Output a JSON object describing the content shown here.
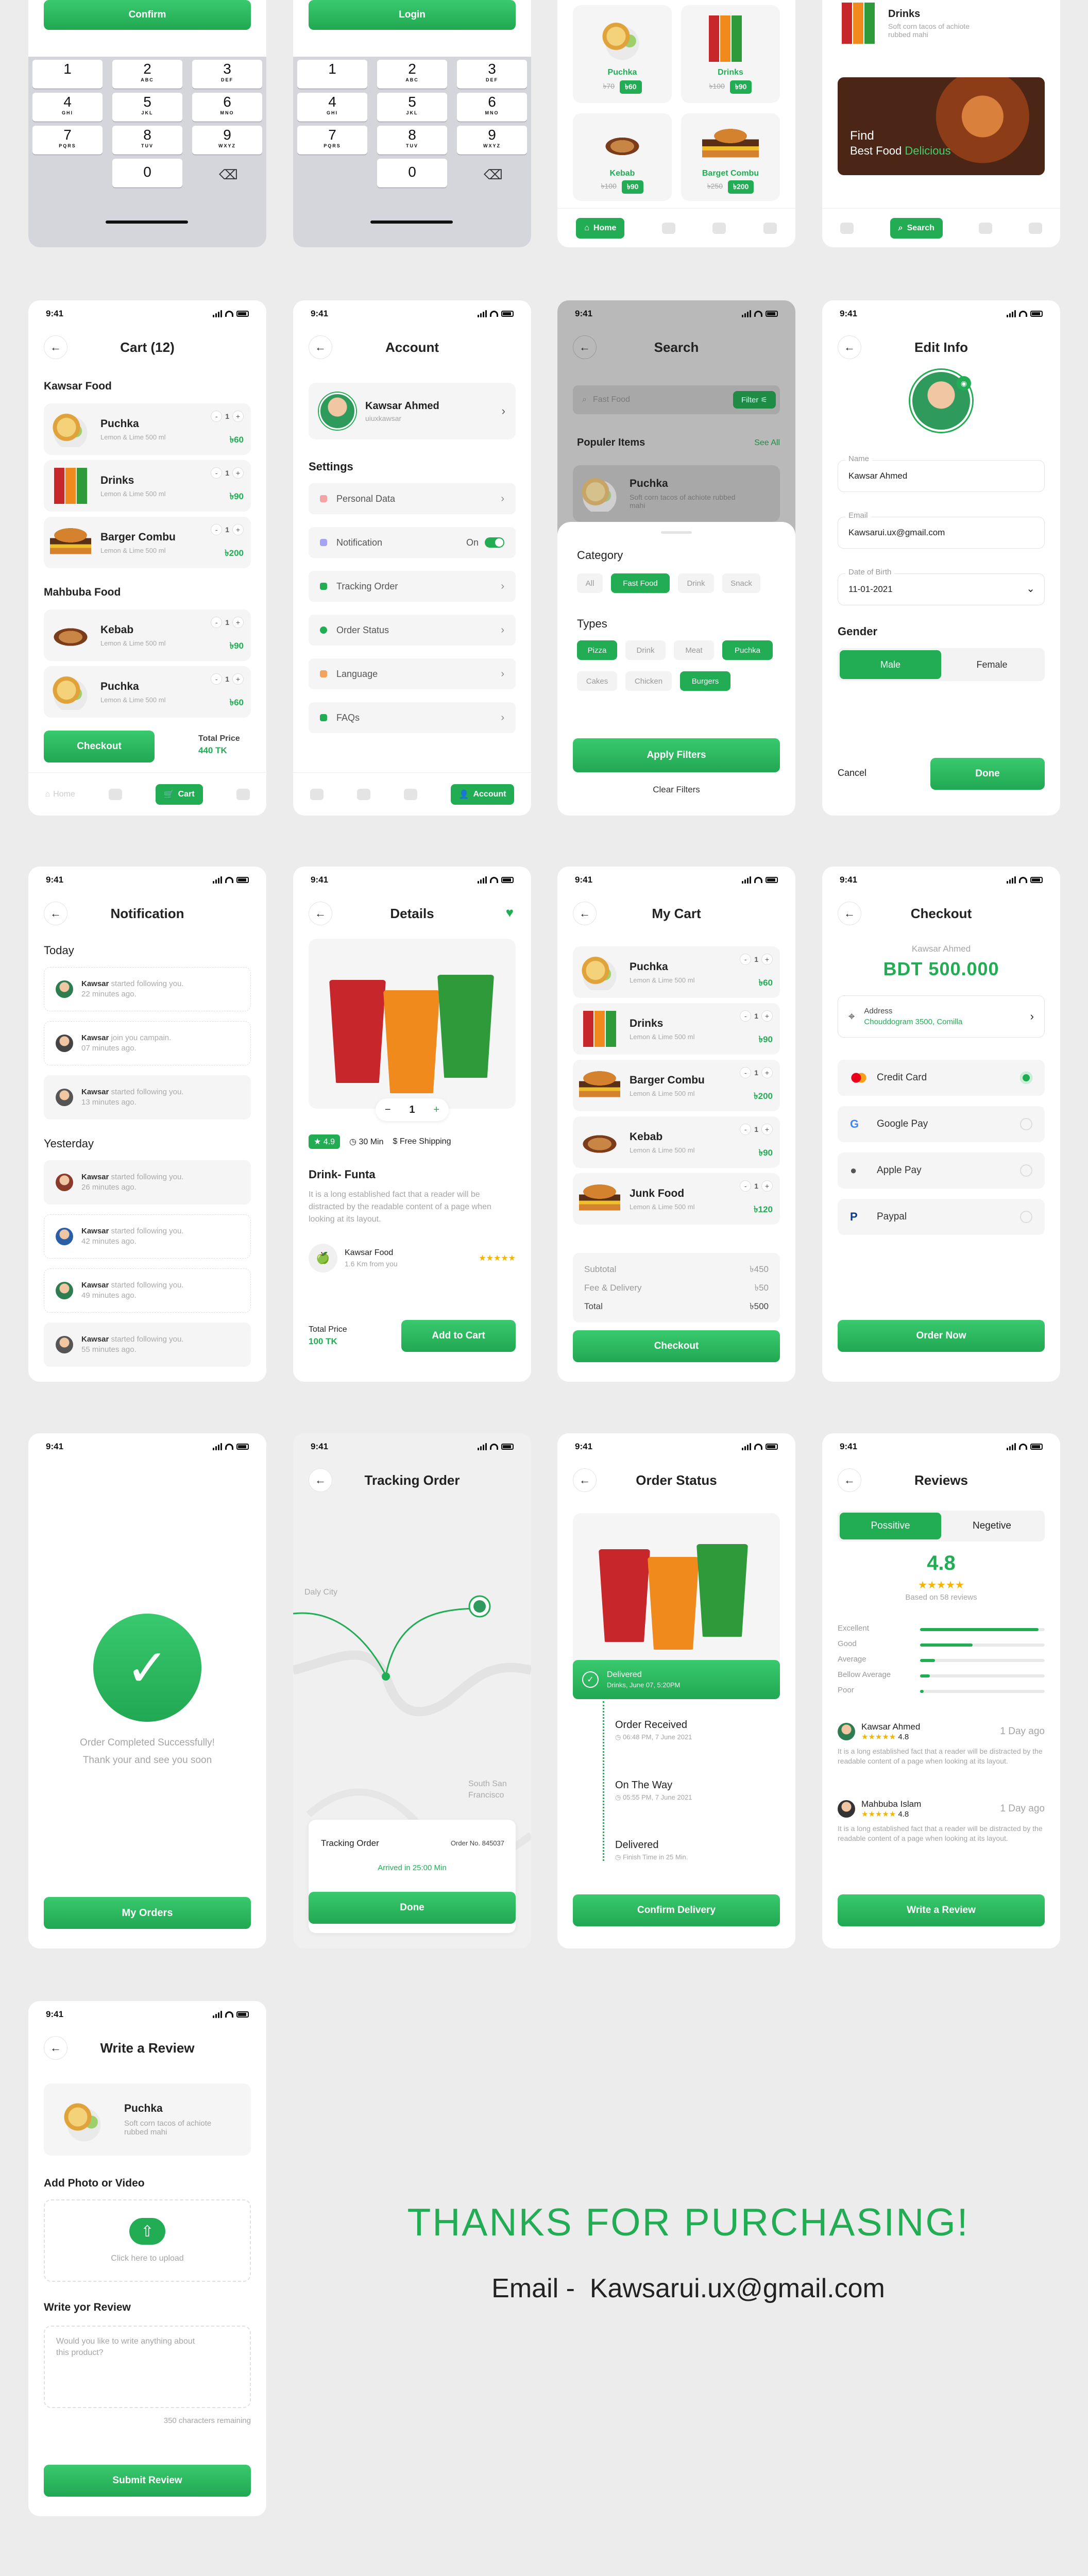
{
  "status_time": "9:41",
  "confirm_screen": {
    "button": "Confirm"
  },
  "login_screen": {
    "button": "Login"
  },
  "keypad": [
    {
      "num": "1",
      "letters": ""
    },
    {
      "num": "2",
      "letters": "ABC"
    },
    {
      "num": "3",
      "letters": "DEF"
    },
    {
      "num": "4",
      "letters": "GHI"
    },
    {
      "num": "5",
      "letters": "JKL"
    },
    {
      "num": "6",
      "letters": "MNO"
    },
    {
      "num": "7",
      "letters": "PQRS"
    },
    {
      "num": "8",
      "letters": "TUV"
    },
    {
      "num": "9",
      "letters": "WXYZ"
    },
    {
      "num": "0",
      "letters": ""
    }
  ],
  "home_grid": {
    "items": [
      {
        "name": "Puchka",
        "old": "৳70",
        "new": "৳60"
      },
      {
        "name": "Drinks",
        "old": "৳100",
        "new": "৳90"
      },
      {
        "name": "Kebab",
        "old": "৳100",
        "new": "৳90"
      },
      {
        "name": "Barget Combu",
        "old": "৳250",
        "new": "৳200"
      }
    ],
    "nav_active": "Home"
  },
  "search_home": {
    "item_name": "Drinks",
    "item_desc": "Soft corn tacos of achiote rubbed mahi",
    "banner_line1": "Find",
    "banner_line2": "Best Food",
    "banner_accent": "Delicious",
    "nav_active": "Search"
  },
  "cart": {
    "title": "Cart (12)",
    "section1": "Kawsar Food",
    "section2": "Mahbuba Food",
    "items1": [
      {
        "name": "Puchka",
        "sub": "Lemon & Lime 500 ml",
        "qty": "1",
        "price": "৳60"
      },
      {
        "name": "Drinks",
        "sub": "Lemon & Lime 500 ml",
        "qty": "1",
        "price": "৳90"
      },
      {
        "name": "Barger Combu",
        "sub": "Lemon & Lime 500 ml",
        "qty": "1",
        "price": "৳200"
      }
    ],
    "items2": [
      {
        "name": "Kebab",
        "sub": "Lemon & Lime 500 ml",
        "qty": "1",
        "price": "৳90"
      },
      {
        "name": "Puchka",
        "sub": "Lemon & Lime 500 ml",
        "qty": "1",
        "price": "৳60"
      }
    ],
    "checkout": "Checkout",
    "total_label": "Total Price",
    "total_value": "440 TK",
    "nav_home": "Home",
    "nav_active": "Cart"
  },
  "account": {
    "title": "Account",
    "name": "Kawsar Ahmed",
    "handle": "uiuxkawsar",
    "settings": "Settings",
    "rows": [
      "Personal Data",
      "Notification",
      "Tracking Order",
      "Order Status",
      "Language",
      "FAQs"
    ],
    "notification_state": "On",
    "nav_active": "Account"
  },
  "search_filter": {
    "title": "Search",
    "placeholder": "Fast Food",
    "filter": "Filter",
    "popular": "Populer Items",
    "see_all": "See All",
    "popular_item": "Puchka",
    "popular_desc": "Soft corn tacos of achiote rubbed mahi",
    "category": "Category",
    "categories": [
      "All",
      "Fast Food",
      "Drink",
      "Snack"
    ],
    "types": "Types",
    "types_row1": [
      "Pizza",
      "Drink",
      "Meat",
      "Puchka"
    ],
    "types_row2": [
      "Cakes",
      "Chicken",
      "Burgers"
    ],
    "apply": "Apply Filters",
    "clear": "Clear Filters"
  },
  "edit_info": {
    "title": "Edit Info",
    "name_label": "Name",
    "name_value": "Kawsar Ahmed",
    "email_label": "Email",
    "email_value": "Kawsarui.ux@gmail.com",
    "dob_label": "Date of Birth",
    "dob_value": "11-01-2021",
    "gender": "Gender",
    "male": "Male",
    "female": "Female",
    "cancel": "Cancel",
    "done": "Done"
  },
  "notification": {
    "title": "Notification",
    "today": "Today",
    "yesterday": "Yesterday",
    "today_items": [
      {
        "who": "Kawsar",
        "what": "started following you.",
        "when": "22 minutes ago."
      },
      {
        "who": "Kawsar",
        "what": "join you campain.",
        "when": "07 minutes ago."
      },
      {
        "who": "Kawsar",
        "what": "started following you.",
        "when": "13 minutes ago."
      }
    ],
    "yesterday_items": [
      {
        "who": "Kawsar",
        "what": "started following you.",
        "when": "26 minutes ago."
      },
      {
        "who": "Kawsar",
        "what": "started following you.",
        "when": "42 minutes ago."
      },
      {
        "who": "Kawsar",
        "what": "started following you.",
        "when": "49 minutes ago."
      },
      {
        "who": "Kawsar",
        "what": "started following you.",
        "when": "55 minutes ago."
      }
    ]
  },
  "details": {
    "title": "Details",
    "qty": "1",
    "rating": "4.9",
    "time": "30 Min",
    "shipping": "Free Shipping",
    "name": "Drink- Funta",
    "desc": "It is a long established fact that a reader will be distracted by the readable content of a page when looking at its layout.",
    "shop": "Kawsar Food",
    "distance": "1.6 Km from you",
    "total_label": "Total Price",
    "total_value": "100 TK",
    "add": "Add to Cart"
  },
  "my_cart": {
    "title": "My Cart",
    "items": [
      {
        "name": "Puchka",
        "sub": "Lemon & Lime 500 ml",
        "qty": "1",
        "price": "৳60"
      },
      {
        "name": "Drinks",
        "sub": "Lemon & Lime 500 ml",
        "qty": "1",
        "price": "৳90"
      },
      {
        "name": "Barger Combu",
        "sub": "Lemon & Lime 500 ml",
        "qty": "1",
        "price": "৳200"
      },
      {
        "name": "Kebab",
        "sub": "Lemon & Lime 500 ml",
        "qty": "1",
        "price": "৳90"
      },
      {
        "name": "Junk Food",
        "sub": "Lemon & Lime 500 ml",
        "qty": "1",
        "price": "৳120"
      }
    ],
    "subtotal_label": "Subtotal",
    "subtotal": "৳450",
    "fee_label": "Fee & Delivery",
    "fee": "৳50",
    "total_label": "Total",
    "total": "৳500",
    "checkout": "Checkout"
  },
  "checkout": {
    "title": "Checkout",
    "name": "Kawsar Ahmed",
    "amount": "BDT 500.000",
    "address_label": "Address",
    "address": "Chouddogram 3500, Comilla",
    "methods": [
      "Credit Card",
      "Google Pay",
      "Apple Pay",
      "Paypal"
    ],
    "order": "Order Now"
  },
  "success": {
    "line1": "Order Completed Successfully!",
    "line2": "Thank your and see you soon",
    "button": "My Orders"
  },
  "tracking": {
    "title": "Tracking Order",
    "city1": "Daly City",
    "city2": "South San Francisco",
    "card_title": "Tracking Order",
    "order_no": "Order No. 845037",
    "arrive": "Arrived in 25:00 Min",
    "done": "Done"
  },
  "order_status": {
    "title": "Order Status",
    "delivered": "Delivered",
    "delivered_sub": "Drinks, June 07, 5:20PM",
    "steps": [
      {
        "label": "Order Received",
        "sub": "06:48 PM, 7 June 2021"
      },
      {
        "label": "On The Way",
        "sub": "05:55 PM, 7 June 2021"
      },
      {
        "label": "Delivered",
        "sub": "Finish Time in 25 Min."
      }
    ],
    "button": "Confirm Delivery"
  },
  "reviews": {
    "title": "Reviews",
    "positive": "Possitive",
    "negative": "Negetive",
    "score": "4.8",
    "based": "Based on 58 reviews",
    "bars": [
      {
        "label": "Excellent",
        "value": 0.95
      },
      {
        "label": "Good",
        "value": 0.42
      },
      {
        "label": "Average",
        "value": 0.12
      },
      {
        "label": "Bellow Average",
        "value": 0.08
      },
      {
        "label": "Poor",
        "value": 0.03
      }
    ],
    "list": [
      {
        "name": "Kawsar Ahmed",
        "rating": "4.8",
        "ago": "1 Day ago",
        "text": "It is a long established fact that a reader will be distracted by the readable content of a page when looking at its layout."
      },
      {
        "name": "Mahbuba Islam",
        "rating": "4.8",
        "ago": "1 Day ago",
        "text": "It is a long established fact that a reader will be distracted by the readable content of a page when looking at its layout."
      }
    ],
    "button": "Write a Review"
  },
  "write_review": {
    "title": "Write a Review",
    "item": "Puchka",
    "item_desc": "Soft corn tacos of achiote rubbed mahi",
    "photo": "Add Photo or Video",
    "upload": "Click here to upload",
    "label": "Write yor Review",
    "placeholder": "Would you like to write anything about this product?",
    "remaining": "350 characters remaining",
    "submit": "Submit Review"
  },
  "thanks": {
    "headline": "THANKS FOR PURCHASING!",
    "email_label": "Email -",
    "email": "Kawsarui.ux@gmail.com"
  },
  "colors": {
    "accent": "#22ad55",
    "background": "#ececec"
  }
}
